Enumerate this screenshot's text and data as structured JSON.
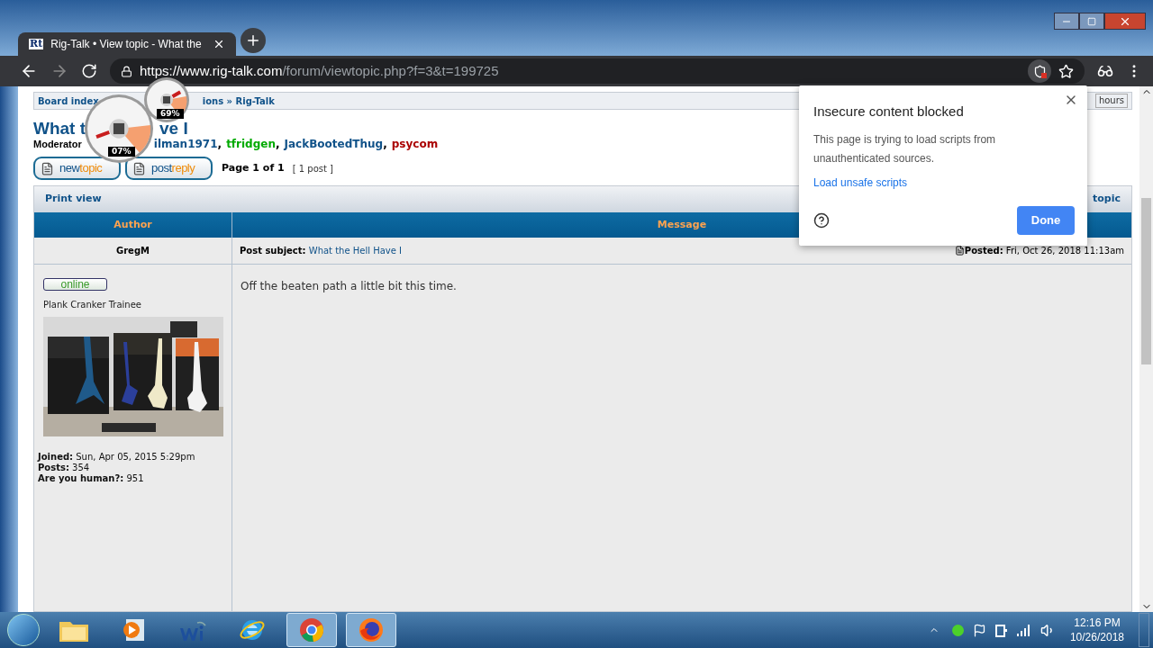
{
  "browser": {
    "tabs": [
      {
        "favicon": "Rt",
        "title": "Rig-Talk • View topic - What the",
        "selected": true
      }
    ],
    "url": {
      "host": "https://www.rig-talk.com",
      "path": "/forum/viewtopic.php?f=3&t=199725"
    }
  },
  "gauges": [
    {
      "reading": "07%"
    },
    {
      "reading": "69%"
    }
  ],
  "page": {
    "breadcrumb": {
      "first": "Board index",
      "rest": "ions » Rig-Talk",
      "end": "hours"
    },
    "title_parts": [
      "What t",
      "ve I"
    ],
    "moderators": {
      "label": "Moderator",
      "separator": ",",
      "names": [
        {
          "name": "ilman1971",
          "color": "#105289"
        },
        {
          "name": "tfridgen",
          "color": "#00aa00"
        },
        {
          "name": "JackBootedThug",
          "color": "#105289"
        },
        {
          "name": "psycom",
          "color": "#aa0000"
        }
      ]
    },
    "buttons": [
      {
        "word1": "new",
        "word2": "topic"
      },
      {
        "word1": "post",
        "word2": "reply"
      }
    ],
    "pagination": "Page 1 of 1",
    "post_count": "[ 1 post ]",
    "print_view": "Print view",
    "bar_end": "topic",
    "columns": [
      "Author",
      "Message"
    ],
    "post": {
      "author": "GregM",
      "subject_label": "Post subject:",
      "subject": "What the Hell Have I",
      "posted_label": "Posted:",
      "posted": "Fri, Oct 26, 2018 11:13am",
      "status": "online",
      "rank": "Plank Cranker Trainee",
      "details": [
        {
          "label": "Joined:",
          "value": "Sun, Apr 05, 2015 5:29pm"
        },
        {
          "label": "Posts:",
          "value": "354"
        },
        {
          "label": "Are you human?:",
          "value": "951"
        }
      ],
      "body": "Off the beaten path a little bit this time."
    }
  },
  "popup": {
    "title": "Insecure content blocked",
    "text": "This page is trying to load scripts from unauthenticated sources.",
    "link": "Load unsafe scripts",
    "button": "Done"
  },
  "taskbar": {
    "apps": [
      {
        "kind": "folder",
        "selected": false
      },
      {
        "kind": "media",
        "selected": false
      },
      {
        "kind": "wi",
        "selected": false
      },
      {
        "kind": "ie",
        "selected": false
      },
      {
        "kind": "chrome",
        "selected": true
      },
      {
        "kind": "firefox",
        "selected": true
      }
    ],
    "time": "12:16 PM",
    "date": "10/26/2018"
  }
}
